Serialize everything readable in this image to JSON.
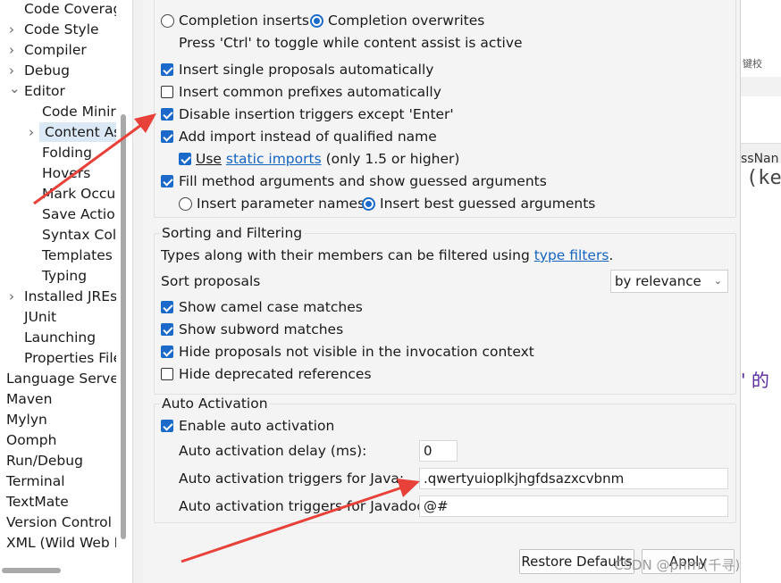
{
  "tree": {
    "items": [
      {
        "label": "Code Coverag",
        "chev": ""
      },
      {
        "label": "Code Style",
        "chev": "›"
      },
      {
        "label": "Compiler",
        "chev": "›"
      },
      {
        "label": "Debug",
        "chev": "›"
      },
      {
        "label": "Editor",
        "chev": "⌄"
      },
      {
        "label": "Code Minir",
        "chev": ""
      },
      {
        "label": "Content As",
        "chev": "›"
      },
      {
        "label": "Folding",
        "chev": ""
      },
      {
        "label": "Hovers",
        "chev": ""
      },
      {
        "label": "Mark Occu",
        "chev": ""
      },
      {
        "label": "Save Actior",
        "chev": ""
      },
      {
        "label": "Syntax Colo",
        "chev": ""
      },
      {
        "label": "Templates",
        "chev": ""
      },
      {
        "label": "Typing",
        "chev": ""
      },
      {
        "label": "Installed JREs",
        "chev": "›"
      },
      {
        "label": "JUnit",
        "chev": ""
      },
      {
        "label": "Launching",
        "chev": ""
      },
      {
        "label": "Properties File",
        "chev": ""
      },
      {
        "label": "Language Server",
        "chev": ""
      },
      {
        "label": "Maven",
        "chev": ""
      },
      {
        "label": "Mylyn",
        "chev": ""
      },
      {
        "label": "Oomph",
        "chev": ""
      },
      {
        "label": "Run/Debug",
        "chev": ""
      },
      {
        "label": "Terminal",
        "chev": ""
      },
      {
        "label": "TextMate",
        "chev": ""
      },
      {
        "label": "Version Control (",
        "chev": ""
      },
      {
        "label": "XML (Wild Web I",
        "chev": ""
      }
    ]
  },
  "insertion": {
    "completion_inserts": "Completion inserts",
    "completion_overwrites": "Completion overwrites",
    "toggle_hint": "Press 'Ctrl' to toggle while content assist is active",
    "insert_single": "Insert single proposals automatically",
    "insert_prefixes": "Insert common prefixes automatically",
    "disable_triggers": "Disable insertion triggers except 'Enter'",
    "add_import": "Add import instead of qualified name",
    "use_label": "Use",
    "static_imports_link": "static imports",
    "static_imports_suffix": "(only 1.5 or higher)",
    "fill_args": "Fill method arguments and show guessed arguments",
    "insert_param_names": "Insert parameter names",
    "insert_best_guessed": "Insert best guessed arguments"
  },
  "sorting": {
    "title": "Sorting and Filtering",
    "types_prefix": "Types along with their members can be filtered using",
    "type_filters_link": "type filters",
    "types_suffix": ".",
    "sort_label": "Sort proposals",
    "sort_value": "by relevance",
    "camel_case": "Show camel case matches",
    "subword": "Show subword matches",
    "hide_not_visible": "Hide proposals not visible in the invocation context",
    "hide_deprecated": "Hide deprecated references"
  },
  "auto": {
    "title": "Auto Activation",
    "enable": "Enable auto activation",
    "delay_label": "Auto activation delay (ms):",
    "delay_value": "0",
    "java_label": "Auto activation triggers for Java:",
    "java_value": ".qwertyuioplkjhgfdsazxcvbnm",
    "javadoc_label": "Auto activation triggers for Javadoc:",
    "javadoc_value": "@#"
  },
  "buttons": {
    "restore_defaults": "Restore Defaults",
    "apply": "Apply"
  },
  "background": {
    "frag1": "键校",
    "frag2": "ssNan",
    "frag3": "(ke",
    "frag4": "' 的"
  },
  "watermark": "CSDN @phrrr(千寻)",
  "colors": {
    "accent": "#1b6ac9",
    "link": "#1564c0",
    "arrow": "#e8413a",
    "selection": "#dbe8f6"
  }
}
